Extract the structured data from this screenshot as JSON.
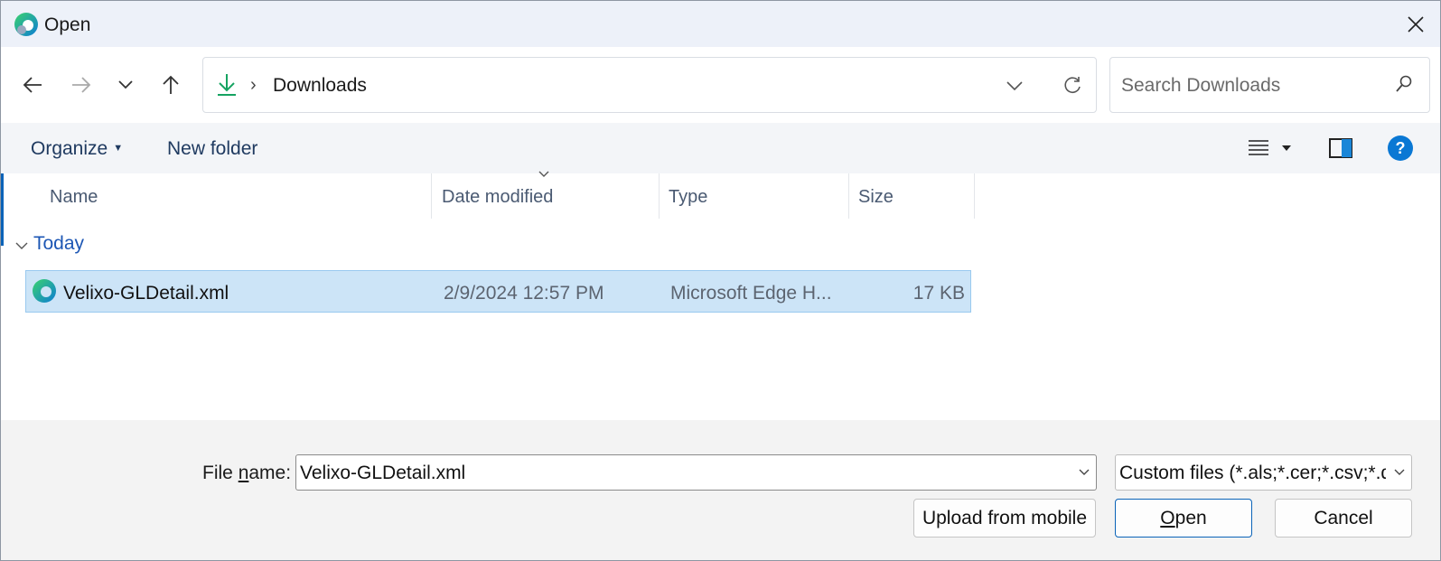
{
  "window": {
    "title": "Open",
    "close_icon": "close-icon"
  },
  "nav": {
    "back_icon": "arrow-left-icon",
    "forward_icon": "arrow-right-icon",
    "recent_icon": "chevron-down-icon",
    "up_icon": "arrow-up-icon",
    "address": {
      "location_icon": "download-icon",
      "path": "Downloads"
    },
    "search": {
      "placeholder": "Search Downloads"
    }
  },
  "toolbar": {
    "organize_label": "Organize",
    "new_folder_label": "New folder",
    "view_icon": "list-view-icon",
    "preview_icon": "preview-pane-icon",
    "help_label": "?"
  },
  "list": {
    "columns": [
      "Name",
      "Date modified",
      "Type",
      "Size"
    ],
    "group_label": "Today",
    "rows": [
      {
        "name": "Velixo-GLDetail.xml",
        "date": "2/9/2024 12:57 PM",
        "type": "Microsoft Edge H...",
        "size": "17 KB",
        "selected": true
      }
    ]
  },
  "footer": {
    "file_name_label_pre": "File ",
    "file_name_label_key": "n",
    "file_name_label_post": "ame:",
    "file_name_value": "Velixo-GLDetail.xml",
    "file_type_value": "Custom files (*.als;*.cer;*.csv;*.d",
    "upload_label": "Upload from mobile",
    "open_label_key": "O",
    "open_label_rest": "pen",
    "cancel_label": "Cancel"
  },
  "colors": {
    "accent": "#0a78d4",
    "selection": "#cce4f7",
    "group": "#1c56b4"
  }
}
